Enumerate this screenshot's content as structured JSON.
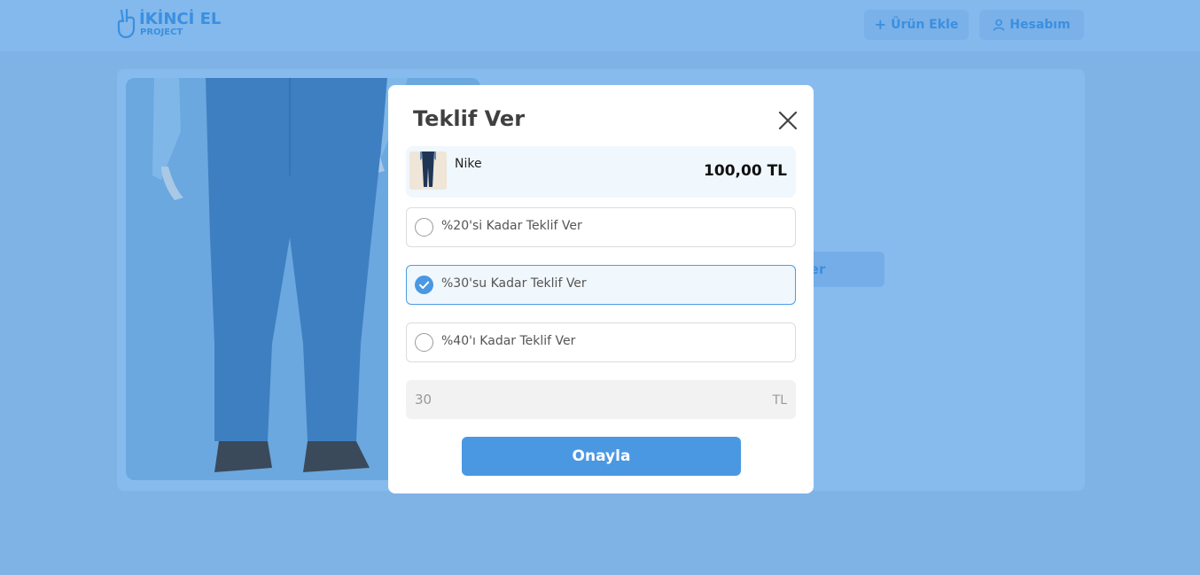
{
  "header": {
    "logo_title": "İKİNCİ EL",
    "logo_subtitle": "PROJECT",
    "add_product_label": "Ürün Ekle",
    "account_label": "Hesabım"
  },
  "background": {
    "offer_button_partial": "ver"
  },
  "modal": {
    "title": "Teklif Ver",
    "product": {
      "name": "Nike",
      "price": "100,00 TL"
    },
    "options": [
      {
        "label": "%20'si Kadar Teklif Ver",
        "selected": false
      },
      {
        "label": "%30'su Kadar Teklif Ver",
        "selected": true
      },
      {
        "label": "%40'ı Kadar Teklif Ver",
        "selected": false
      }
    ],
    "amount": {
      "value": "30",
      "unit": "TL"
    },
    "confirm_label": "Onayla"
  },
  "colors": {
    "overlay_bg": "#7fb3e6",
    "primary": "#4a98e2",
    "selected_option_bg": "#f0f7fd",
    "text_dark": "#404040"
  },
  "icons": {
    "close": "close-icon",
    "add": "plus-icon",
    "account": "user-icon",
    "check": "check-icon",
    "logo": "hand-peace-icon"
  }
}
